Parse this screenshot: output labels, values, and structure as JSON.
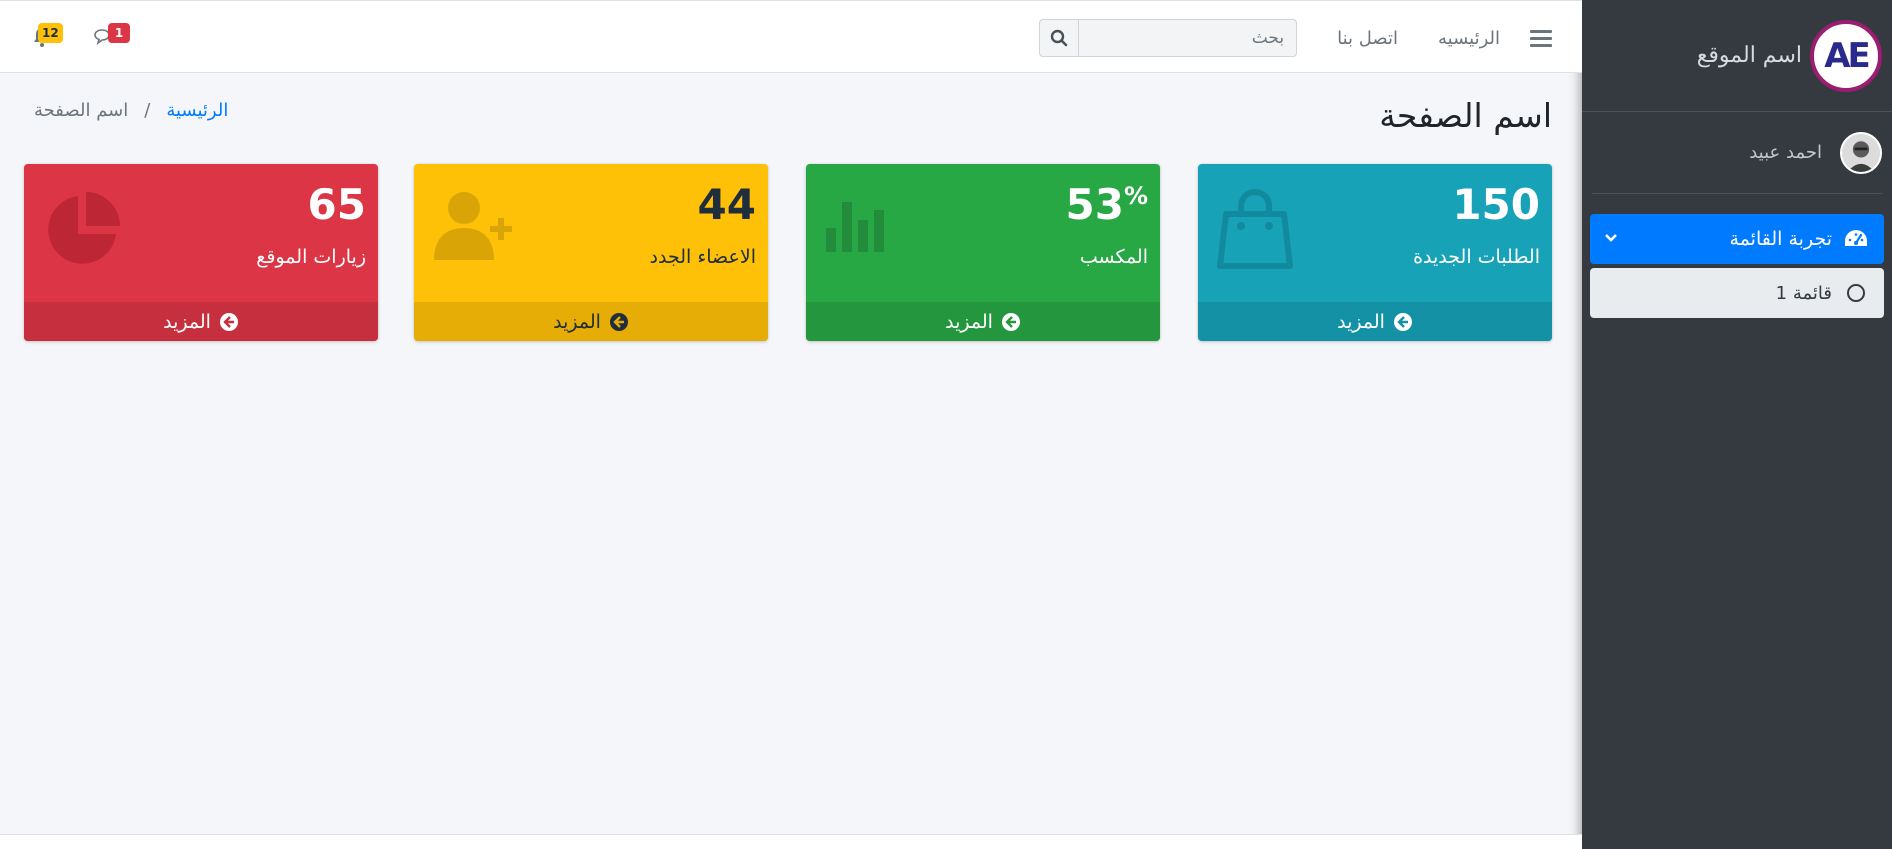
{
  "sidebar": {
    "brand_logo_text": "AE",
    "brand_name": "اسم الموقع",
    "user_name": "احمد عبيد",
    "menu": {
      "label": "تجربة القائمة",
      "icon": "tachometer-icon",
      "sub_items": [
        {
          "label": "قائمة 1",
          "icon": "circle-outline-icon"
        }
      ]
    }
  },
  "navbar": {
    "links": [
      "الرئيسيه",
      "اتصل بنا"
    ],
    "search_placeholder": "بحث",
    "messages_count": "1",
    "notifications_count": "12"
  },
  "header": {
    "page_title": "اسم الصفحة",
    "breadcrumb_home": "الرئيسية",
    "breadcrumb_separator": "/",
    "breadcrumb_current": "اسم الصفحة"
  },
  "boxes": [
    {
      "value": "150",
      "suffix": "",
      "label": "الطلبات الجديدة",
      "more": "المزيد",
      "color": "#17a2b8",
      "icon": "shopping-bag-icon"
    },
    {
      "value": "53",
      "suffix": "%",
      "label": "المكسب",
      "more": "المزيد",
      "color": "#28a745",
      "icon": "bar-chart-icon"
    },
    {
      "value": "44",
      "suffix": "",
      "label": "الاعضاء الجدد",
      "more": "المزيد",
      "color": "#ffc107",
      "icon": "user-plus-icon"
    },
    {
      "value": "65",
      "suffix": "",
      "label": "زيارات الموقع",
      "more": "المزيد",
      "color": "#dc3545",
      "icon": "pie-chart-icon"
    }
  ]
}
